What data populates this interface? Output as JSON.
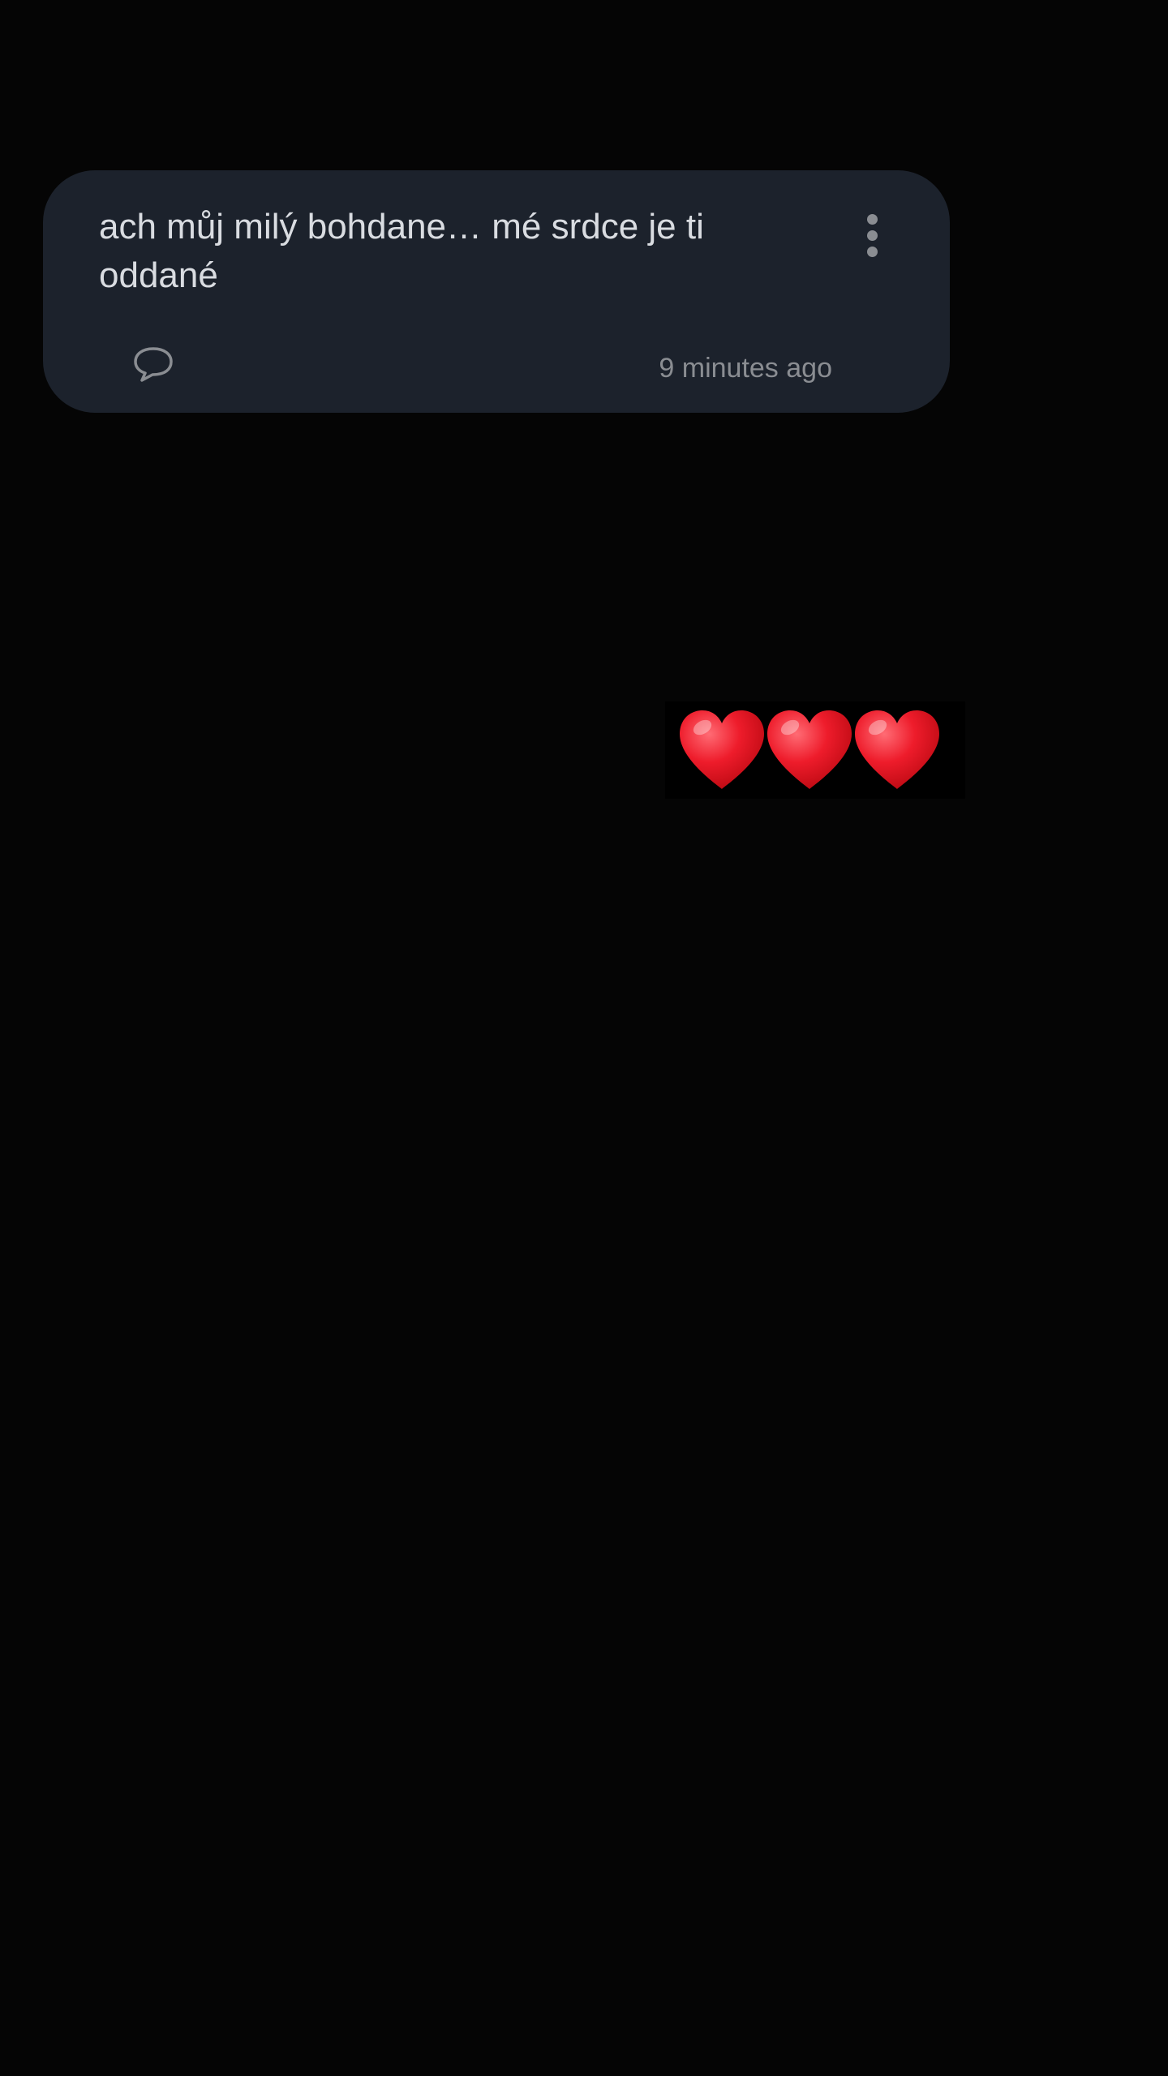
{
  "note": {
    "text": "ach můj milý bohdane… mé srdce je ti oddané",
    "timestamp": "9 minutes ago",
    "more_icon": "more-vertical-icon",
    "comment_icon": "comment-bubble-icon"
  },
  "decoration": {
    "emoji": "❤️❤️❤️",
    "emoji_icon": "heart-emoji-icon",
    "heart_color": "#e0121f"
  },
  "colors": {
    "background": "#050505",
    "card": "#1c222c",
    "text": "#d9dce1",
    "muted": "#8a8d92"
  }
}
